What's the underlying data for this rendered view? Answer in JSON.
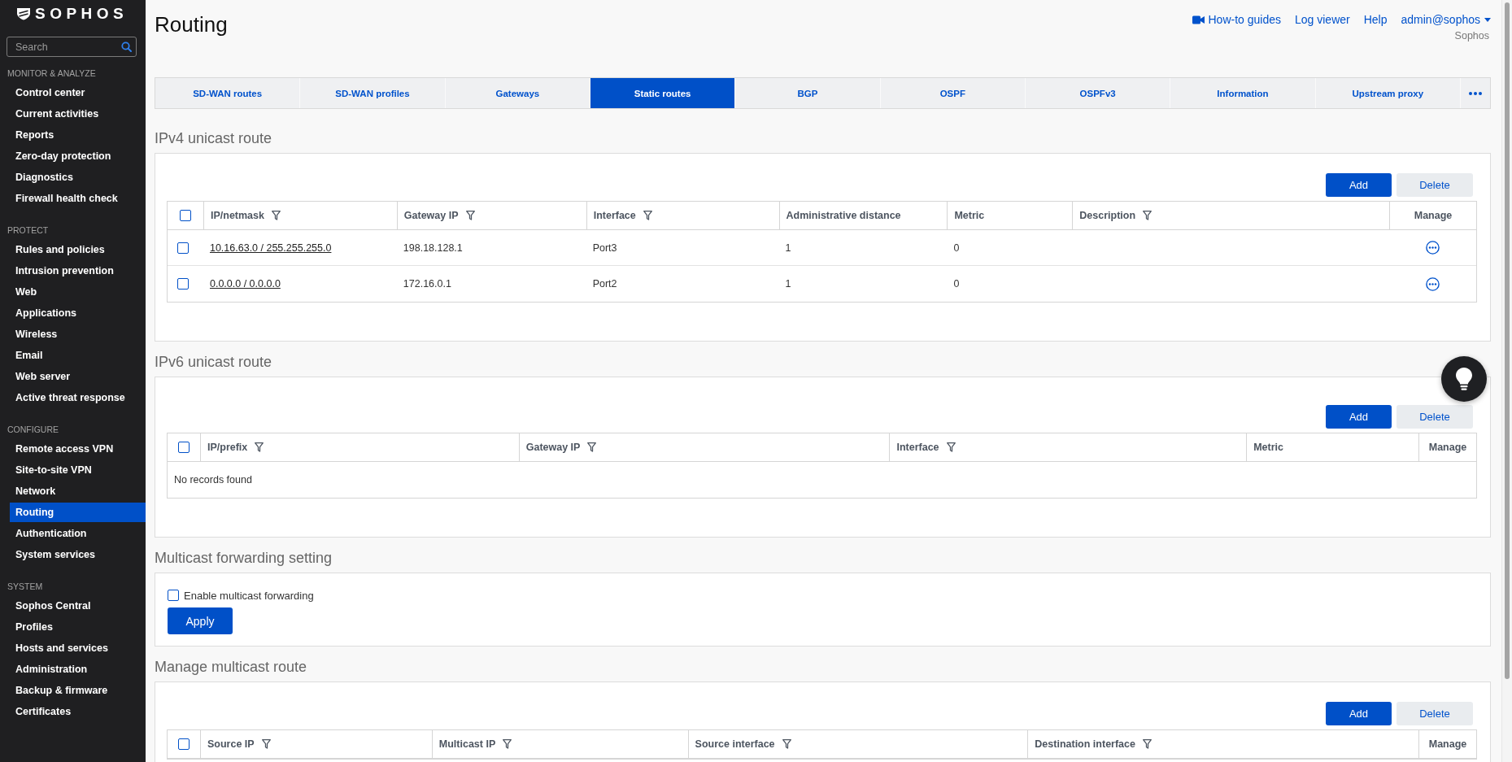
{
  "sidebar": {
    "logo": "SOPHOS",
    "search": {
      "placeholder": "Search"
    },
    "sections": [
      {
        "title": "MONITOR & ANALYZE",
        "items": [
          {
            "label": "Control center",
            "selected": false
          },
          {
            "label": "Current activities",
            "selected": false
          },
          {
            "label": "Reports",
            "selected": false
          },
          {
            "label": "Zero-day protection",
            "selected": false
          },
          {
            "label": "Diagnostics",
            "selected": false
          },
          {
            "label": "Firewall health check",
            "selected": false
          }
        ]
      },
      {
        "title": "PROTECT",
        "items": [
          {
            "label": "Rules and policies",
            "selected": false
          },
          {
            "label": "Intrusion prevention",
            "selected": false
          },
          {
            "label": "Web",
            "selected": false
          },
          {
            "label": "Applications",
            "selected": false
          },
          {
            "label": "Wireless",
            "selected": false
          },
          {
            "label": "Email",
            "selected": false
          },
          {
            "label": "Web server",
            "selected": false
          },
          {
            "label": "Active threat response",
            "selected": false
          }
        ]
      },
      {
        "title": "CONFIGURE",
        "items": [
          {
            "label": "Remote access VPN",
            "selected": false
          },
          {
            "label": "Site-to-site VPN",
            "selected": false
          },
          {
            "label": "Network",
            "selected": false
          },
          {
            "label": "Routing",
            "selected": true
          },
          {
            "label": "Authentication",
            "selected": false
          },
          {
            "label": "System services",
            "selected": false
          }
        ]
      },
      {
        "title": "SYSTEM",
        "items": [
          {
            "label": "Sophos Central",
            "selected": false
          },
          {
            "label": "Profiles",
            "selected": false
          },
          {
            "label": "Hosts and services",
            "selected": false
          },
          {
            "label": "Administration",
            "selected": false
          },
          {
            "label": "Backup & firmware",
            "selected": false
          },
          {
            "label": "Certificates",
            "selected": false
          }
        ]
      }
    ]
  },
  "header": {
    "title": "Routing",
    "links": [
      {
        "label": "How-to guides",
        "kind": "video"
      },
      {
        "label": "Log viewer",
        "kind": "link"
      },
      {
        "label": "Help",
        "kind": "link"
      },
      {
        "label": "admin@sophos",
        "kind": "menu"
      }
    ],
    "subtitle": "Sophos"
  },
  "tabs": [
    {
      "label": "SD-WAN routes",
      "selected": false
    },
    {
      "label": "SD-WAN profiles",
      "selected": false
    },
    {
      "label": "Gateways",
      "selected": false
    },
    {
      "label": "Static routes",
      "selected": true
    },
    {
      "label": "BGP",
      "selected": false
    },
    {
      "label": "OSPF",
      "selected": false
    },
    {
      "label": "OSPFv3",
      "selected": false
    },
    {
      "label": "Information",
      "selected": false
    },
    {
      "label": "Upstream proxy",
      "selected": false
    }
  ],
  "sections": [
    {
      "kind": "table",
      "title": "IPv4 unicast route",
      "buttons": [
        {
          "label": "Add",
          "kind": "primary"
        },
        {
          "label": "Delete",
          "kind": "secondary"
        }
      ],
      "table": {
        "select_all": {
          "checked": false
        },
        "columns": [
          {
            "label": "IP/netmask",
            "kind": "link",
            "filter": true
          },
          {
            "label": "Gateway IP",
            "kind": "text",
            "filter": true
          },
          {
            "label": "Interface",
            "kind": "text",
            "filter": true
          },
          {
            "label": "Administrative distance",
            "kind": "text"
          },
          {
            "label": "Metric",
            "kind": "text"
          },
          {
            "label": "Description",
            "kind": "text",
            "filter": true
          },
          {
            "label": "Manage",
            "kind": "action"
          }
        ],
        "rows": [
          {
            "checked": false,
            "cells": [
              "10.16.63.0 / 255.255.255.0",
              "198.18.128.1",
              "Port3",
              "1",
              "0"
            ]
          },
          {
            "checked": false,
            "cells": [
              "0.0.0.0 / 0.0.0.0",
              "172.16.0.1",
              "Port2",
              "1",
              "0"
            ]
          }
        ]
      }
    },
    {
      "kind": "table",
      "title": "IPv6 unicast route",
      "buttons": [
        {
          "label": "Add",
          "kind": "primary"
        },
        {
          "label": "Delete",
          "kind": "secondary"
        }
      ],
      "table": {
        "select_all": {
          "checked": false
        },
        "columns": [
          {
            "label": "IP/prefix",
            "kind": "text",
            "filter": true
          },
          {
            "label": "Gateway IP",
            "kind": "text",
            "filter": true
          },
          {
            "label": "Interface",
            "kind": "text",
            "filter": true
          },
          {
            "label": "Metric",
            "kind": "text"
          },
          {
            "label": "Manage",
            "kind": "action"
          }
        ],
        "empty_text": "No records found"
      }
    },
    {
      "kind": "form",
      "title": "Multicast forwarding setting",
      "checkbox": {
        "label": "Enable multicast forwarding",
        "checked": false
      },
      "button": {
        "label": "Apply",
        "kind": "primary"
      }
    },
    {
      "kind": "table",
      "title": "Manage multicast route",
      "buttons": [
        {
          "label": "Add",
          "kind": "primary"
        },
        {
          "label": "Delete",
          "kind": "secondary"
        }
      ],
      "table": {
        "select_all": {
          "checked": false
        },
        "columns": [
          {
            "label": "Source IP",
            "kind": "text",
            "filter": true
          },
          {
            "label": "Multicast IP",
            "kind": "text",
            "filter": true
          },
          {
            "label": "Source interface",
            "kind": "text",
            "filter": true
          },
          {
            "label": "Destination interface",
            "kind": "text",
            "filter": true
          },
          {
            "label": "Manage",
            "kind": "action"
          }
        ]
      }
    }
  ]
}
